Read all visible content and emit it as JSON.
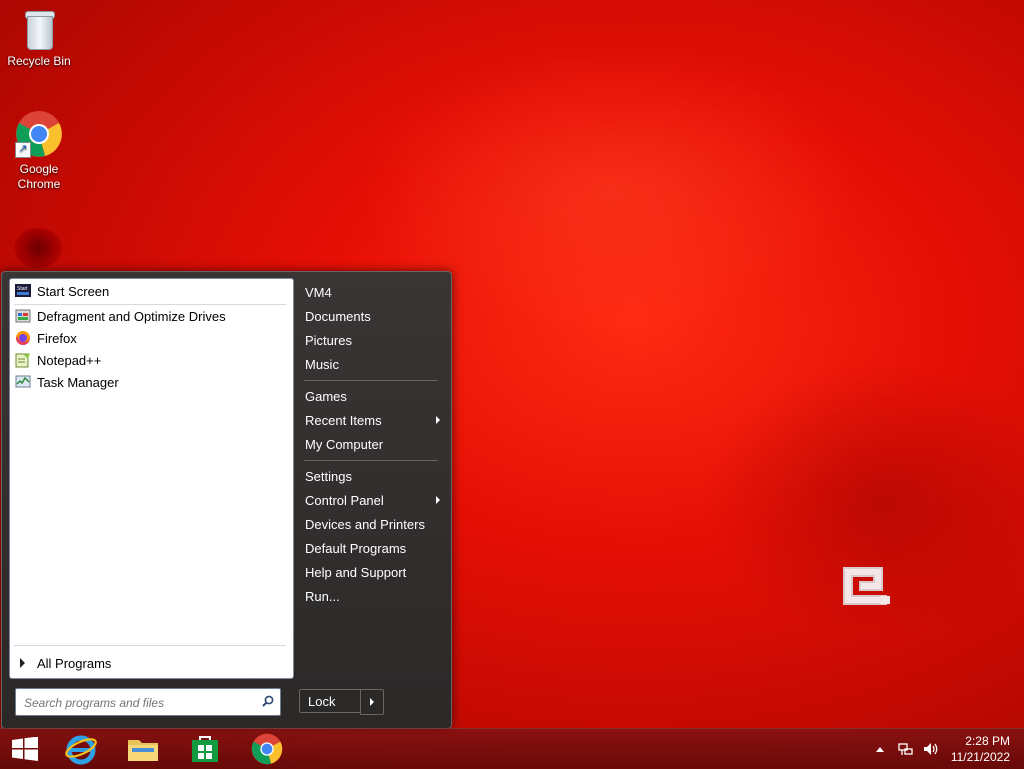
{
  "desktop": {
    "icons": [
      {
        "label": "Recycle Bin",
        "icon": "recycle-bin-icon"
      },
      {
        "label": "Google\nChrome",
        "icon": "chrome-icon"
      }
    ]
  },
  "start_menu": {
    "programs": [
      {
        "label": "Start Screen",
        "icon": "start-screen-icon"
      },
      {
        "label": "Defragment and Optimize Drives",
        "icon": "defrag-icon"
      },
      {
        "label": "Firefox",
        "icon": "firefox-icon"
      },
      {
        "label": "Notepad++",
        "icon": "notepadpp-icon"
      },
      {
        "label": "Task Manager",
        "icon": "task-manager-icon"
      }
    ],
    "all_programs": "All Programs",
    "search_placeholder": "Search programs and files",
    "right_items": [
      {
        "label": "VM4"
      },
      {
        "label": "Documents"
      },
      {
        "label": "Pictures"
      },
      {
        "label": "Music"
      },
      {
        "label": "Games"
      },
      {
        "label": "Recent Items",
        "submenu": true
      },
      {
        "label": "My Computer"
      },
      {
        "label": "Settings"
      },
      {
        "label": "Control Panel",
        "submenu": true
      },
      {
        "label": "Devices and Printers"
      },
      {
        "label": "Default Programs"
      },
      {
        "label": "Help and Support"
      },
      {
        "label": "Run..."
      }
    ],
    "lock_label": "Lock"
  },
  "taskbar": {
    "pinned": [
      "windows-start-icon",
      "internet-explorer-icon",
      "file-explorer-icon",
      "store-icon",
      "chrome-icon"
    ],
    "tray_icons": [
      "show-hidden-icons-icon",
      "network-icon",
      "volume-icon"
    ],
    "time": "2:28 PM",
    "date": "11/21/2022"
  },
  "colors": {
    "wallpaper": "#e60f05",
    "menu_dark": "#2b2828",
    "taskbar": "#6e0f0f"
  }
}
